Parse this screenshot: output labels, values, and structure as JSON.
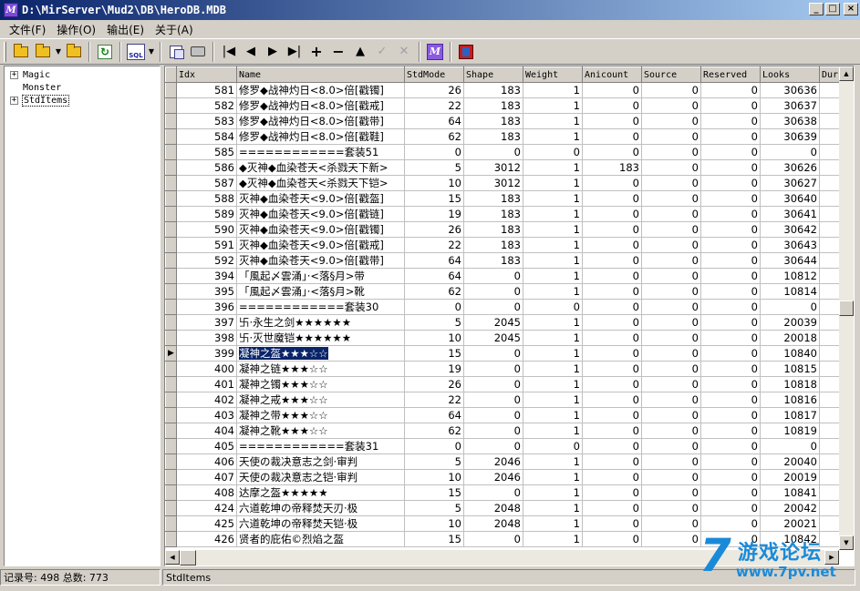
{
  "window": {
    "title": "D:\\MirServer\\Mud2\\DB\\HeroDB.MDB",
    "min": "_",
    "max": "□",
    "close": "×"
  },
  "menu": [
    "文件(F)",
    "操作(O)",
    "输出(E)",
    "关于(A)"
  ],
  "tree": {
    "nodes": [
      {
        "label": "Magic",
        "expandable": true,
        "selected": false
      },
      {
        "label": "Monster",
        "expandable": false,
        "selected": false
      },
      {
        "label": "StdItems",
        "expandable": true,
        "selected": true
      }
    ]
  },
  "grid": {
    "columns": [
      "Idx",
      "Name",
      "StdMode",
      "Shape",
      "Weight",
      "Anicount",
      "Source",
      "Reserved",
      "Looks",
      "Dur"
    ],
    "selected_row_index": 17,
    "rows": [
      [
        "581",
        "修罗◆战神灼日<8.0>倍[戳镯]",
        "26",
        "183",
        "1",
        "0",
        "0",
        "0",
        "30636"
      ],
      [
        "582",
        "修罗◆战神灼日<8.0>倍[戳戒]",
        "22",
        "183",
        "1",
        "0",
        "0",
        "0",
        "30637"
      ],
      [
        "583",
        "修罗◆战神灼日<8.0>倍[戳带]",
        "64",
        "183",
        "1",
        "0",
        "0",
        "0",
        "30638"
      ],
      [
        "584",
        "修罗◆战神灼日<8.0>倍[戳鞋]",
        "62",
        "183",
        "1",
        "0",
        "0",
        "0",
        "30639"
      ],
      [
        "585",
        "============套装51",
        "0",
        "0",
        "0",
        "0",
        "0",
        "0",
        "0"
      ],
      [
        "586",
        "◆灭神◆血染苍天<杀戮天下新>",
        "5",
        "3012",
        "1",
        "183",
        "0",
        "0",
        "30626"
      ],
      [
        "587",
        "◆灭神◆血染苍天<杀戮天下铠>",
        "10",
        "3012",
        "1",
        "0",
        "0",
        "0",
        "30627"
      ],
      [
        "588",
        "灭神◆血染苍天<9.0>倍[戳盔]",
        "15",
        "183",
        "1",
        "0",
        "0",
        "0",
        "30640"
      ],
      [
        "589",
        "灭神◆血染苍天<9.0>倍[戳链]",
        "19",
        "183",
        "1",
        "0",
        "0",
        "0",
        "30641"
      ],
      [
        "590",
        "灭神◆血染苍天<9.0>倍[戳镯]",
        "26",
        "183",
        "1",
        "0",
        "0",
        "0",
        "30642"
      ],
      [
        "591",
        "灭神◆血染苍天<9.0>倍[戳戒]",
        "22",
        "183",
        "1",
        "0",
        "0",
        "0",
        "30643"
      ],
      [
        "592",
        "灭神◆血染苍天<9.0>倍[戳带]",
        "64",
        "183",
        "1",
        "0",
        "0",
        "0",
        "30644"
      ],
      [
        "394",
        "「風起〆雲涌」·<落§月>带",
        "64",
        "0",
        "1",
        "0",
        "0",
        "0",
        "10812"
      ],
      [
        "395",
        "「風起〆雲涌」·<落§月>靴",
        "62",
        "0",
        "1",
        "0",
        "0",
        "0",
        "10814"
      ],
      [
        "396",
        "============套装30",
        "0",
        "0",
        "0",
        "0",
        "0",
        "0",
        "0"
      ],
      [
        "397",
        "卐·永生之剑★★★★★★",
        "5",
        "2045",
        "1",
        "0",
        "0",
        "0",
        "20039"
      ],
      [
        "398",
        "卐·灭世魔铠★★★★★★",
        "10",
        "2045",
        "1",
        "0",
        "0",
        "0",
        "20018"
      ],
      [
        "399",
        "凝神之盔★★★☆☆",
        "15",
        "0",
        "1",
        "0",
        "0",
        "0",
        "10840"
      ],
      [
        "400",
        "凝神之链★★★☆☆",
        "19",
        "0",
        "1",
        "0",
        "0",
        "0",
        "10815"
      ],
      [
        "401",
        "凝神之镯★★★☆☆",
        "26",
        "0",
        "1",
        "0",
        "0",
        "0",
        "10818"
      ],
      [
        "402",
        "凝神之戒★★★☆☆",
        "22",
        "0",
        "1",
        "0",
        "0",
        "0",
        "10816"
      ],
      [
        "403",
        "凝神之带★★★☆☆",
        "64",
        "0",
        "1",
        "0",
        "0",
        "0",
        "10817"
      ],
      [
        "404",
        "凝神之靴★★★☆☆",
        "62",
        "0",
        "1",
        "0",
        "0",
        "0",
        "10819"
      ],
      [
        "405",
        "============套装31",
        "0",
        "0",
        "0",
        "0",
        "0",
        "0",
        "0"
      ],
      [
        "406",
        "天使の裁决意志之剑·审判",
        "5",
        "2046",
        "1",
        "0",
        "0",
        "0",
        "20040"
      ],
      [
        "407",
        "天使の裁决意志之铠·审判",
        "10",
        "2046",
        "1",
        "0",
        "0",
        "0",
        "20019"
      ],
      [
        "408",
        "达摩之盔★★★★★",
        "15",
        "0",
        "1",
        "0",
        "0",
        "0",
        "10841"
      ],
      [
        "424",
        "六道乾坤の帝释焚天刃·极",
        "5",
        "2048",
        "1",
        "0",
        "0",
        "0",
        "20042"
      ],
      [
        "425",
        "六道乾坤の帝释焚天铠·极",
        "10",
        "2048",
        "1",
        "0",
        "0",
        "0",
        "20021"
      ],
      [
        "426",
        "贤者的庇佑©烈焰之盔",
        "15",
        "0",
        "1",
        "0",
        "0",
        "0",
        "10842"
      ]
    ]
  },
  "status": {
    "record": "记录号: 498 总数: 773",
    "table": "StdItems"
  },
  "watermark": {
    "seven": "7",
    "title": "游戏论坛",
    "url": "www.7pv.net"
  },
  "colors": {
    "title_gradient_start": "#0a246a",
    "title_gradient_end": "#a6caf0",
    "selection": "#0a246a",
    "chrome": "#d4d0c8",
    "watermark": "#1a8ad8"
  }
}
